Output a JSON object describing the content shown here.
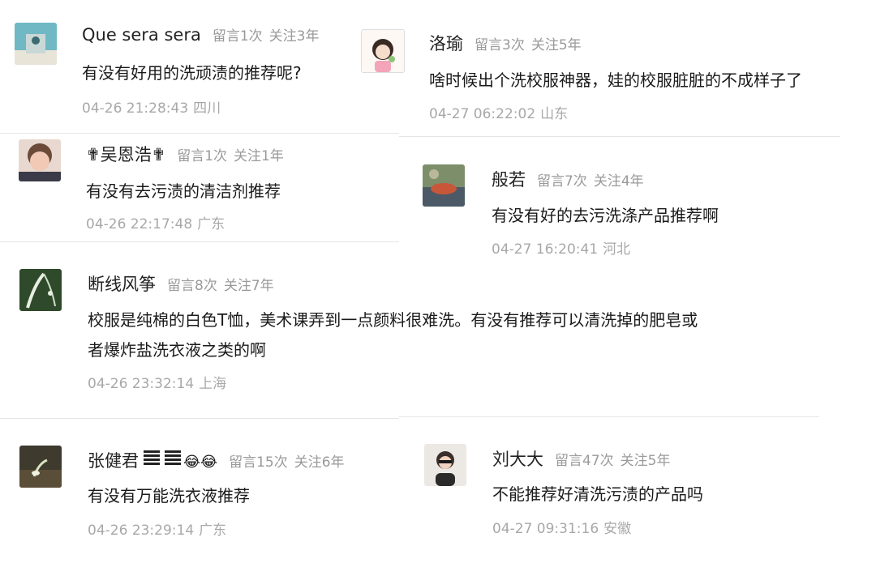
{
  "comments": [
    {
      "name": "Que sera sera",
      "msgs": "留言1次",
      "follow": "关注3年",
      "content": "有没有好用的洗顽渍的推荐呢?",
      "time": "04-26 21:28:43",
      "loc": "四川"
    },
    {
      "name": "洛瑜",
      "msgs": "留言3次",
      "follow": "关注5年",
      "content": "啥时候出个洗校服神器，娃的校服脏脏的不成样子了",
      "time": "04-27 06:22:02",
      "loc": "山东"
    },
    {
      "name": "✟吴恩浩✟",
      "msgs": "留言1次",
      "follow": "关注1年",
      "content": "有没有去污渍的清洁剂推荐",
      "time": "04-26 22:17:48",
      "loc": "广东"
    },
    {
      "name": "般若",
      "msgs": "留言7次",
      "follow": "关注4年",
      "content": "有没有好的去污洗涤产品推荐啊",
      "time": "04-27 16:20:41",
      "loc": "河北"
    },
    {
      "name": "断线风筝",
      "msgs": "留言8次",
      "follow": "关注7年",
      "content_line1": "校服是纯棉的白色T恤，美术课弄到一点颜料很难洗。有没有推荐可以清洗掉的肥皂或",
      "content_line2": "者爆炸盐洗衣液之类的啊",
      "time": "04-26 23:32:14",
      "loc": "上海"
    },
    {
      "name": "张健君",
      "emoji": "😂😂",
      "msgs": "留言15次",
      "follow": "关注6年",
      "content": "有没有万能洗衣液推荐",
      "time": "04-26 23:29:14",
      "loc": "广东"
    },
    {
      "name": "刘大大",
      "msgs": "留言47次",
      "follow": "关注5年",
      "content": "不能推荐好清洗污渍的产品吗",
      "time": "04-27 09:31:16",
      "loc": "安徽"
    }
  ]
}
